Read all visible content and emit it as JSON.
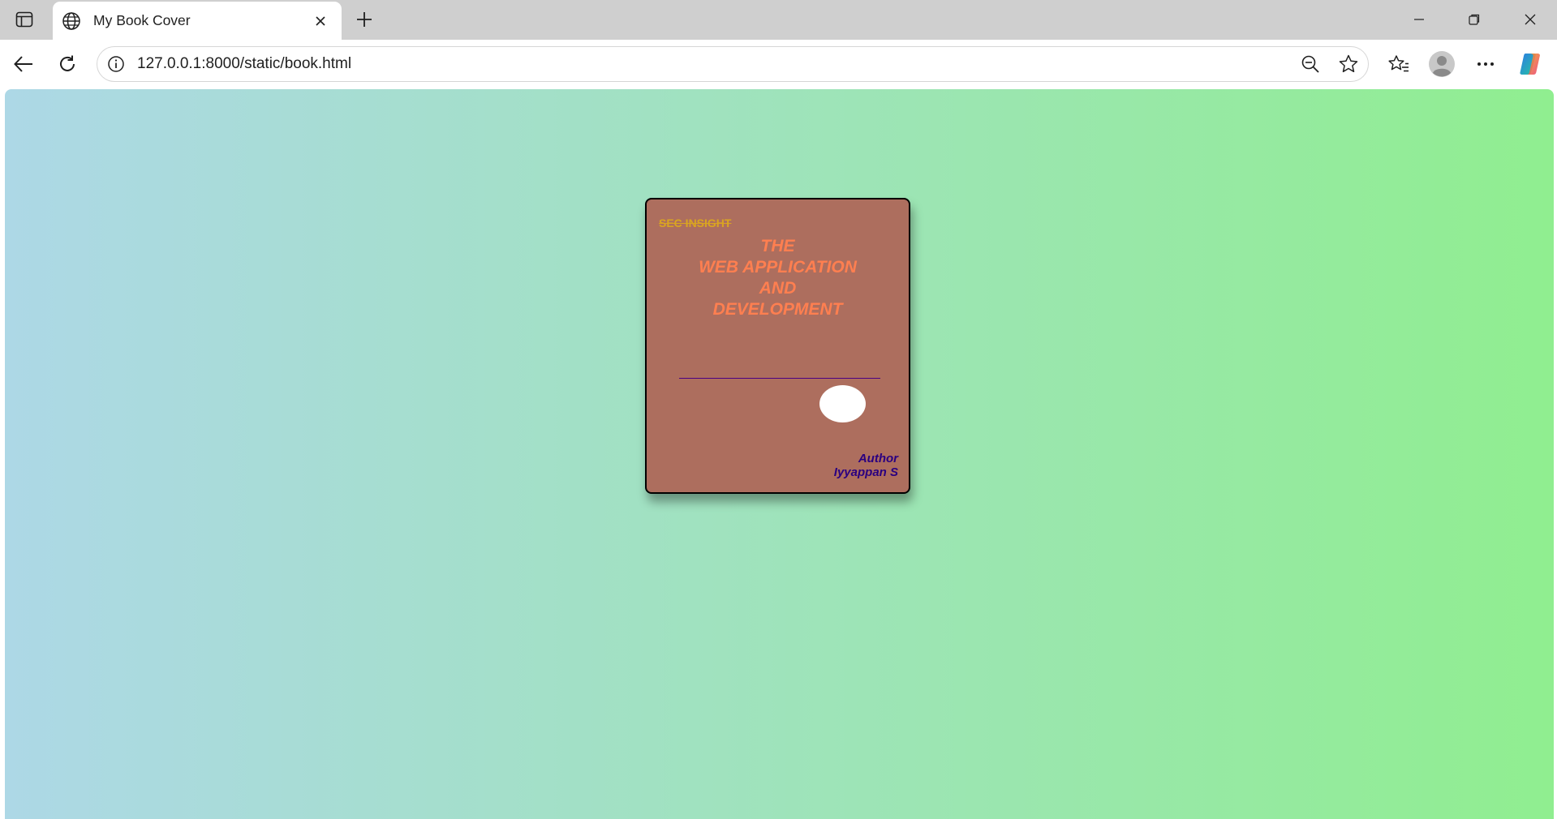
{
  "tab": {
    "title": "My Book Cover"
  },
  "address_bar": {
    "url": "127.0.0.1:8000/static/book.html"
  },
  "icons": {
    "sidebar": "vertical-tabs-icon",
    "favicon": "globe-icon",
    "close": "close-icon",
    "new_tab": "plus-icon",
    "back": "back-arrow-icon",
    "refresh": "refresh-icon",
    "site_info": "info-icon",
    "zoom": "zoom-out-icon",
    "favorite": "star-icon",
    "favorites": "favorites-icon",
    "profile": "avatar-icon",
    "menu": "more-icon",
    "copilot": "copilot-icon"
  },
  "page": {
    "background_colors": [
      "#add8e6",
      "#90ee90"
    ],
    "book": {
      "background_color": "#ad6e5e",
      "publisher": "SEC INSIGHT",
      "title_lines": [
        "THE",
        "WEB APPLICATION",
        "AND",
        "DEVELOPMENT"
      ],
      "title_color": "#ff7f50",
      "author_label": "Author",
      "author_name": "Iyyappan S",
      "author_color": "#2a0080"
    }
  }
}
